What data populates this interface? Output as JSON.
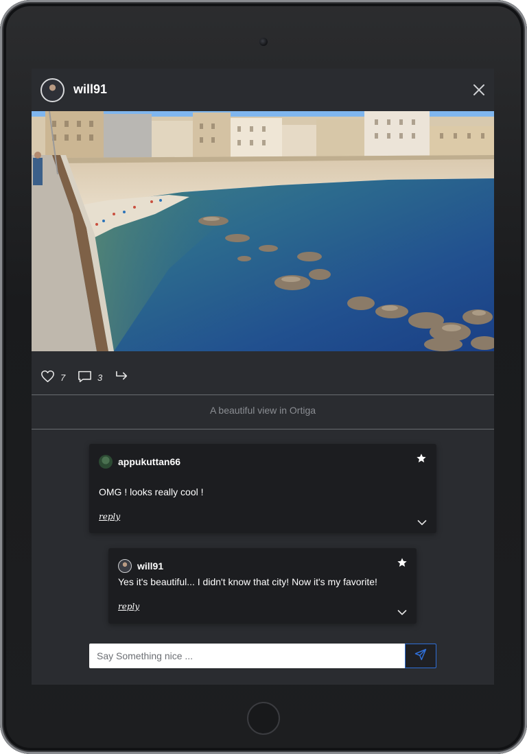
{
  "post": {
    "username": "will91",
    "likes": "7",
    "comments_count": "3",
    "caption": "A beautiful view in Ortiga"
  },
  "comments": [
    {
      "username": "appukuttan66",
      "text": "OMG ! looks really cool !",
      "reply_label": "reply"
    },
    {
      "username": "will91",
      "text": "Yes it's beautiful... I didn't know that city! Now it's my favorite!",
      "reply_label": "reply"
    }
  ],
  "composer": {
    "placeholder": "Say Something nice ..."
  },
  "icons": {
    "close": "close-icon",
    "like": "heart-icon",
    "comment": "comment-icon",
    "share": "share-icon",
    "favorite": "star-icon",
    "expand": "chevron-down-icon",
    "send": "send-icon"
  },
  "colors": {
    "screen_bg": "#2a2c30",
    "card_bg": "#1c1d20",
    "accent": "#2f6fd8"
  }
}
